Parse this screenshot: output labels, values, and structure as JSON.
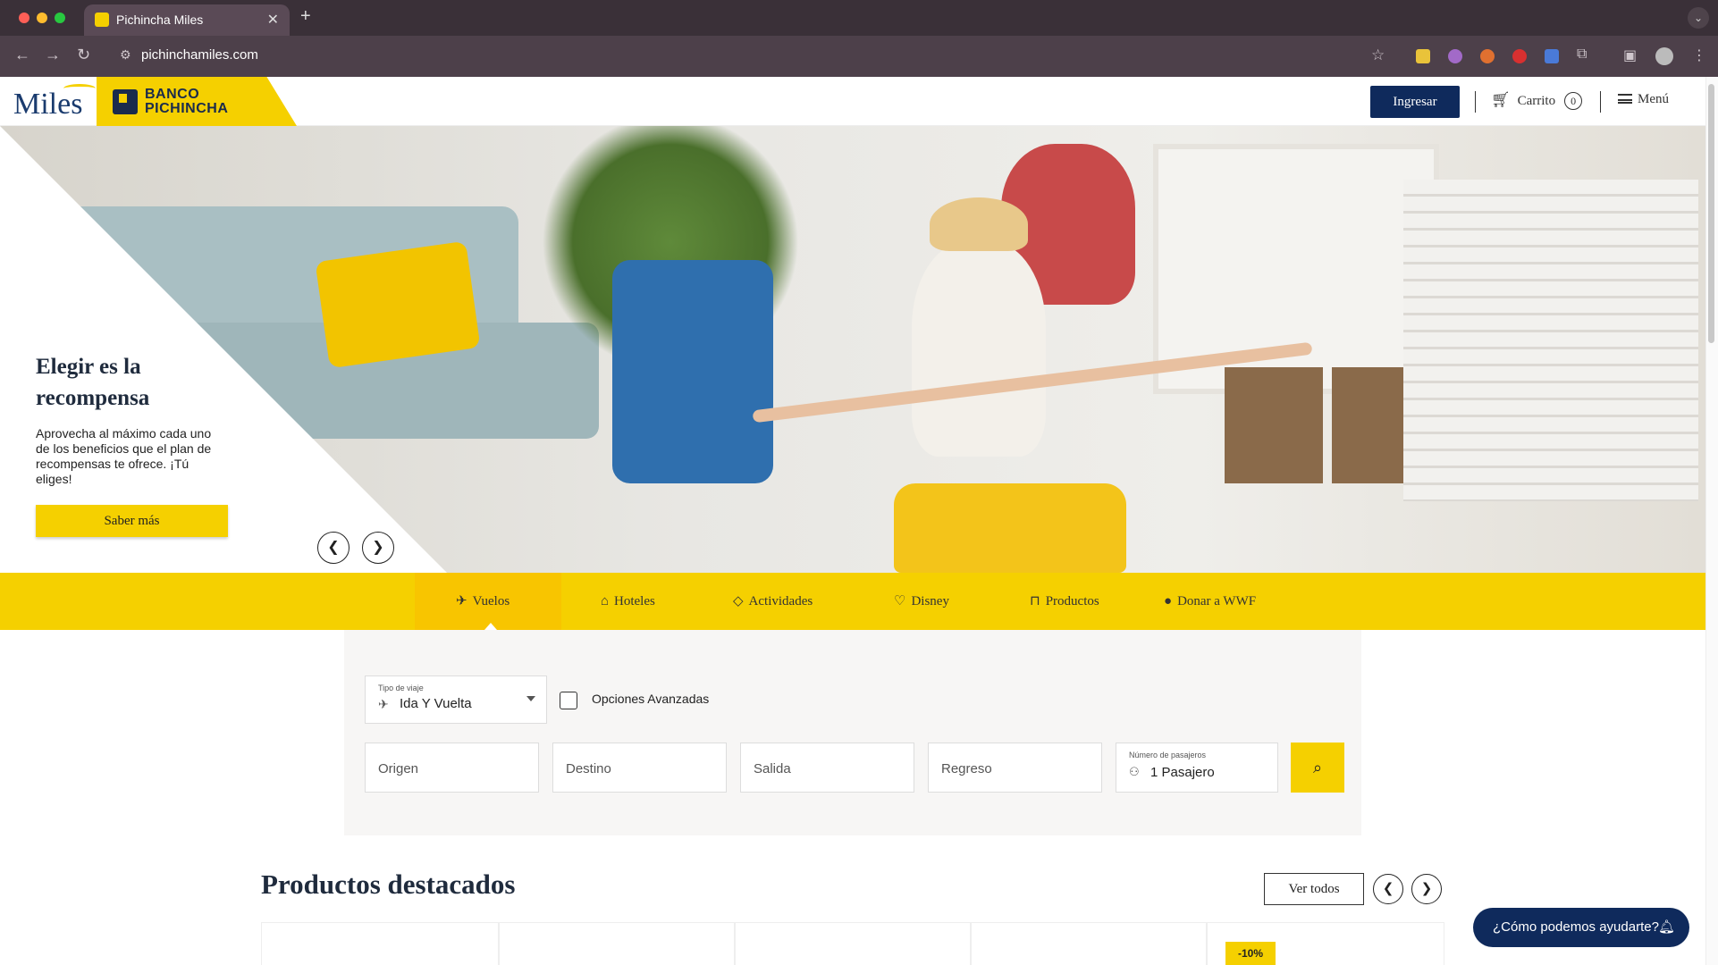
{
  "browser": {
    "tab_title": "Pichincha Miles",
    "url": "pichinchamiles.com",
    "colors": {
      "chrome": "#3a3038",
      "toolbar": "#4d404a"
    }
  },
  "header": {
    "logo_miles": "Miles",
    "logo_banco_line1": "BANCO",
    "logo_banco_line2": "PICHINCHA",
    "login_label": "Ingresar",
    "cart_label": "Carrito",
    "cart_count": "0",
    "menu_label": "Menú"
  },
  "hero": {
    "title": "Elegir es la recompensa",
    "text": "Aprovecha al máximo cada uno de los beneficios que el plan de recompensas te ofrece. ¡Tú eliges!",
    "button_label": "Saber más",
    "prev_icon": "chevron-left-icon",
    "next_icon": "chevron-right-icon"
  },
  "categories": [
    {
      "label": "Vuelos",
      "icon": "plane-icon"
    },
    {
      "label": "Hoteles",
      "icon": "bed-icon"
    },
    {
      "label": "Actividades",
      "icon": "ticket-icon"
    },
    {
      "label": "Disney",
      "icon": "mickey-icon"
    },
    {
      "label": "Productos",
      "icon": "bag-icon"
    },
    {
      "label": "Donar a WWF",
      "icon": "panda-icon"
    }
  ],
  "search": {
    "trip_type_label": "Tipo de viaje",
    "trip_type_value": "Ida Y Vuelta",
    "advanced_label": "Opciones Avanzadas",
    "origin_placeholder": "Origen",
    "destination_placeholder": "Destino",
    "departure_placeholder": "Salida",
    "return_placeholder": "Regreso",
    "passengers_label": "Número de pasajeros",
    "passengers_value": "1 Pasajero"
  },
  "featured": {
    "title": "Productos destacados",
    "see_all_label": "Ver todos",
    "badge": "-10%"
  },
  "help": {
    "label": "¿Cómo podemos ayudarte?"
  },
  "colors": {
    "brand_yellow": "#f5d000",
    "brand_navy": "#0f2a5c"
  }
}
